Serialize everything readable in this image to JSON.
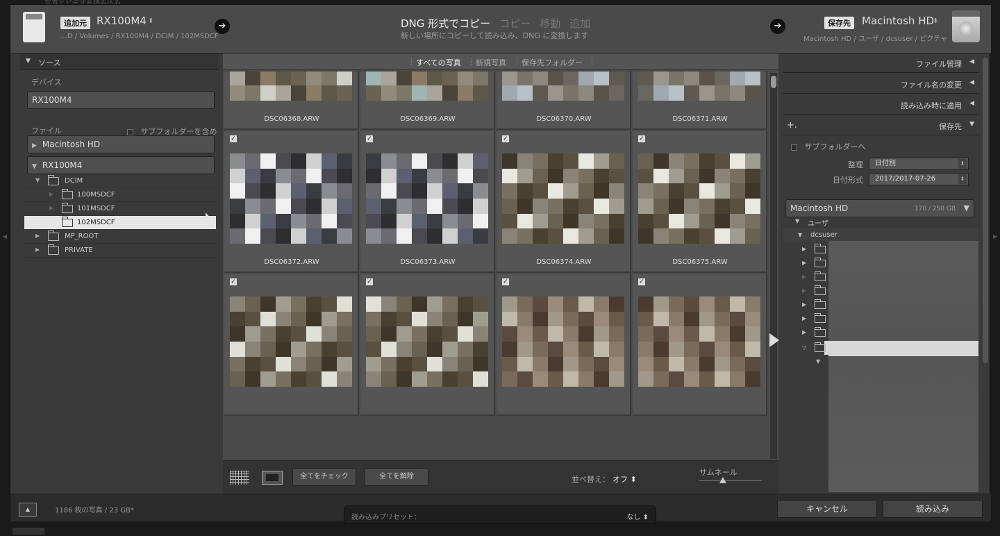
{
  "window_title": "写真とビデオを読み込み",
  "header": {
    "source_badge": "追加元",
    "source_name": "RX100M4",
    "source_caret": "⬍",
    "source_path": "…D / Volumes / RX100M4 / DCIM / 102MSDCF",
    "arrow": "➔",
    "modes": [
      "DNG 形式でコピー",
      "コピー",
      "移動",
      "追加"
    ],
    "active_mode": 0,
    "mode_subtitle": "新しい場所にコピーして読み込み、DNG に変換します",
    "dest_badge": "保存先",
    "dest_name": "Macintosh HD",
    "dest_caret": "⬍",
    "dest_path": "Macintosh HD / ユーザ / dcsuser / ピクチャ"
  },
  "left_panel": {
    "header": "ソース",
    "device_label": "デバイス",
    "device_button": "RX100M4",
    "file_label": "ファイル",
    "include_subfolders": "サブフォルダーを含める",
    "volume_mac": "Macintosh HD",
    "volume_card": "RX100M4",
    "tree": [
      {
        "name": "DCIM",
        "level": 1,
        "expanded": true
      },
      {
        "name": "100MSDCF",
        "level": 2
      },
      {
        "name": "101MSDCF",
        "level": 2
      },
      {
        "name": "102MSDCF",
        "level": 2,
        "selected": true
      },
      {
        "name": "MP_ROOT",
        "level": 1
      },
      {
        "name": "PRIVATE",
        "level": 1
      }
    ]
  },
  "center": {
    "tabs": [
      "すべての写真",
      "新規写真",
      "保存先フォルダー"
    ],
    "active_tab": 0,
    "thumbnails": [
      {
        "file": "DSC06368.ARW",
        "checked": true
      },
      {
        "file": "DSC06369.ARW",
        "checked": true
      },
      {
        "file": "DSC06370.ARW",
        "checked": true
      },
      {
        "file": "DSC06371.ARW",
        "checked": true
      },
      {
        "file": "DSC06372.ARW",
        "checked": true
      },
      {
        "file": "DSC06373.ARW",
        "checked": true
      },
      {
        "file": "DSC06374.ARW",
        "checked": true
      },
      {
        "file": "DSC06375.ARW",
        "checked": true
      },
      {
        "file": "",
        "checked": true
      },
      {
        "file": "",
        "checked": true
      },
      {
        "file": "",
        "checked": true
      },
      {
        "file": "",
        "checked": true
      }
    ],
    "check_all": "全てをチェック",
    "uncheck_all": "全てを解除",
    "sort_label": "並べ替え：",
    "sort_value": "オフ ⬍",
    "thumbnail_label": "サムネール"
  },
  "right_panel": {
    "file_handling": "ファイル管理",
    "file_rename": "ファイル名の変更",
    "apply_during_import": "読み込み時に適用",
    "destination": "保存先",
    "plus": "+.",
    "into_subfolder": "サブフォルダーへ",
    "organize_label": "整理",
    "organize_value": "日付別",
    "date_format_label": "日付形式",
    "date_format_value": "2017/2017-07-26",
    "volume_name": "Macintosh HD",
    "volume_capacity": "170 / 250 GB",
    "tree_users": "ユーザ",
    "tree_user": "dcsuser"
  },
  "bottom": {
    "up": "▲",
    "photo_count": "1186 枚の写真 / 23 GB*",
    "preset_label": "読み込みプリセット：",
    "preset_value": "なし ⬍",
    "cancel": "キャンセル",
    "import": "読み込み"
  },
  "colors": {
    "panel_bg": "#3a3a3a",
    "header_bg": "#4a4a4a",
    "selection": "#e6e6e6"
  }
}
